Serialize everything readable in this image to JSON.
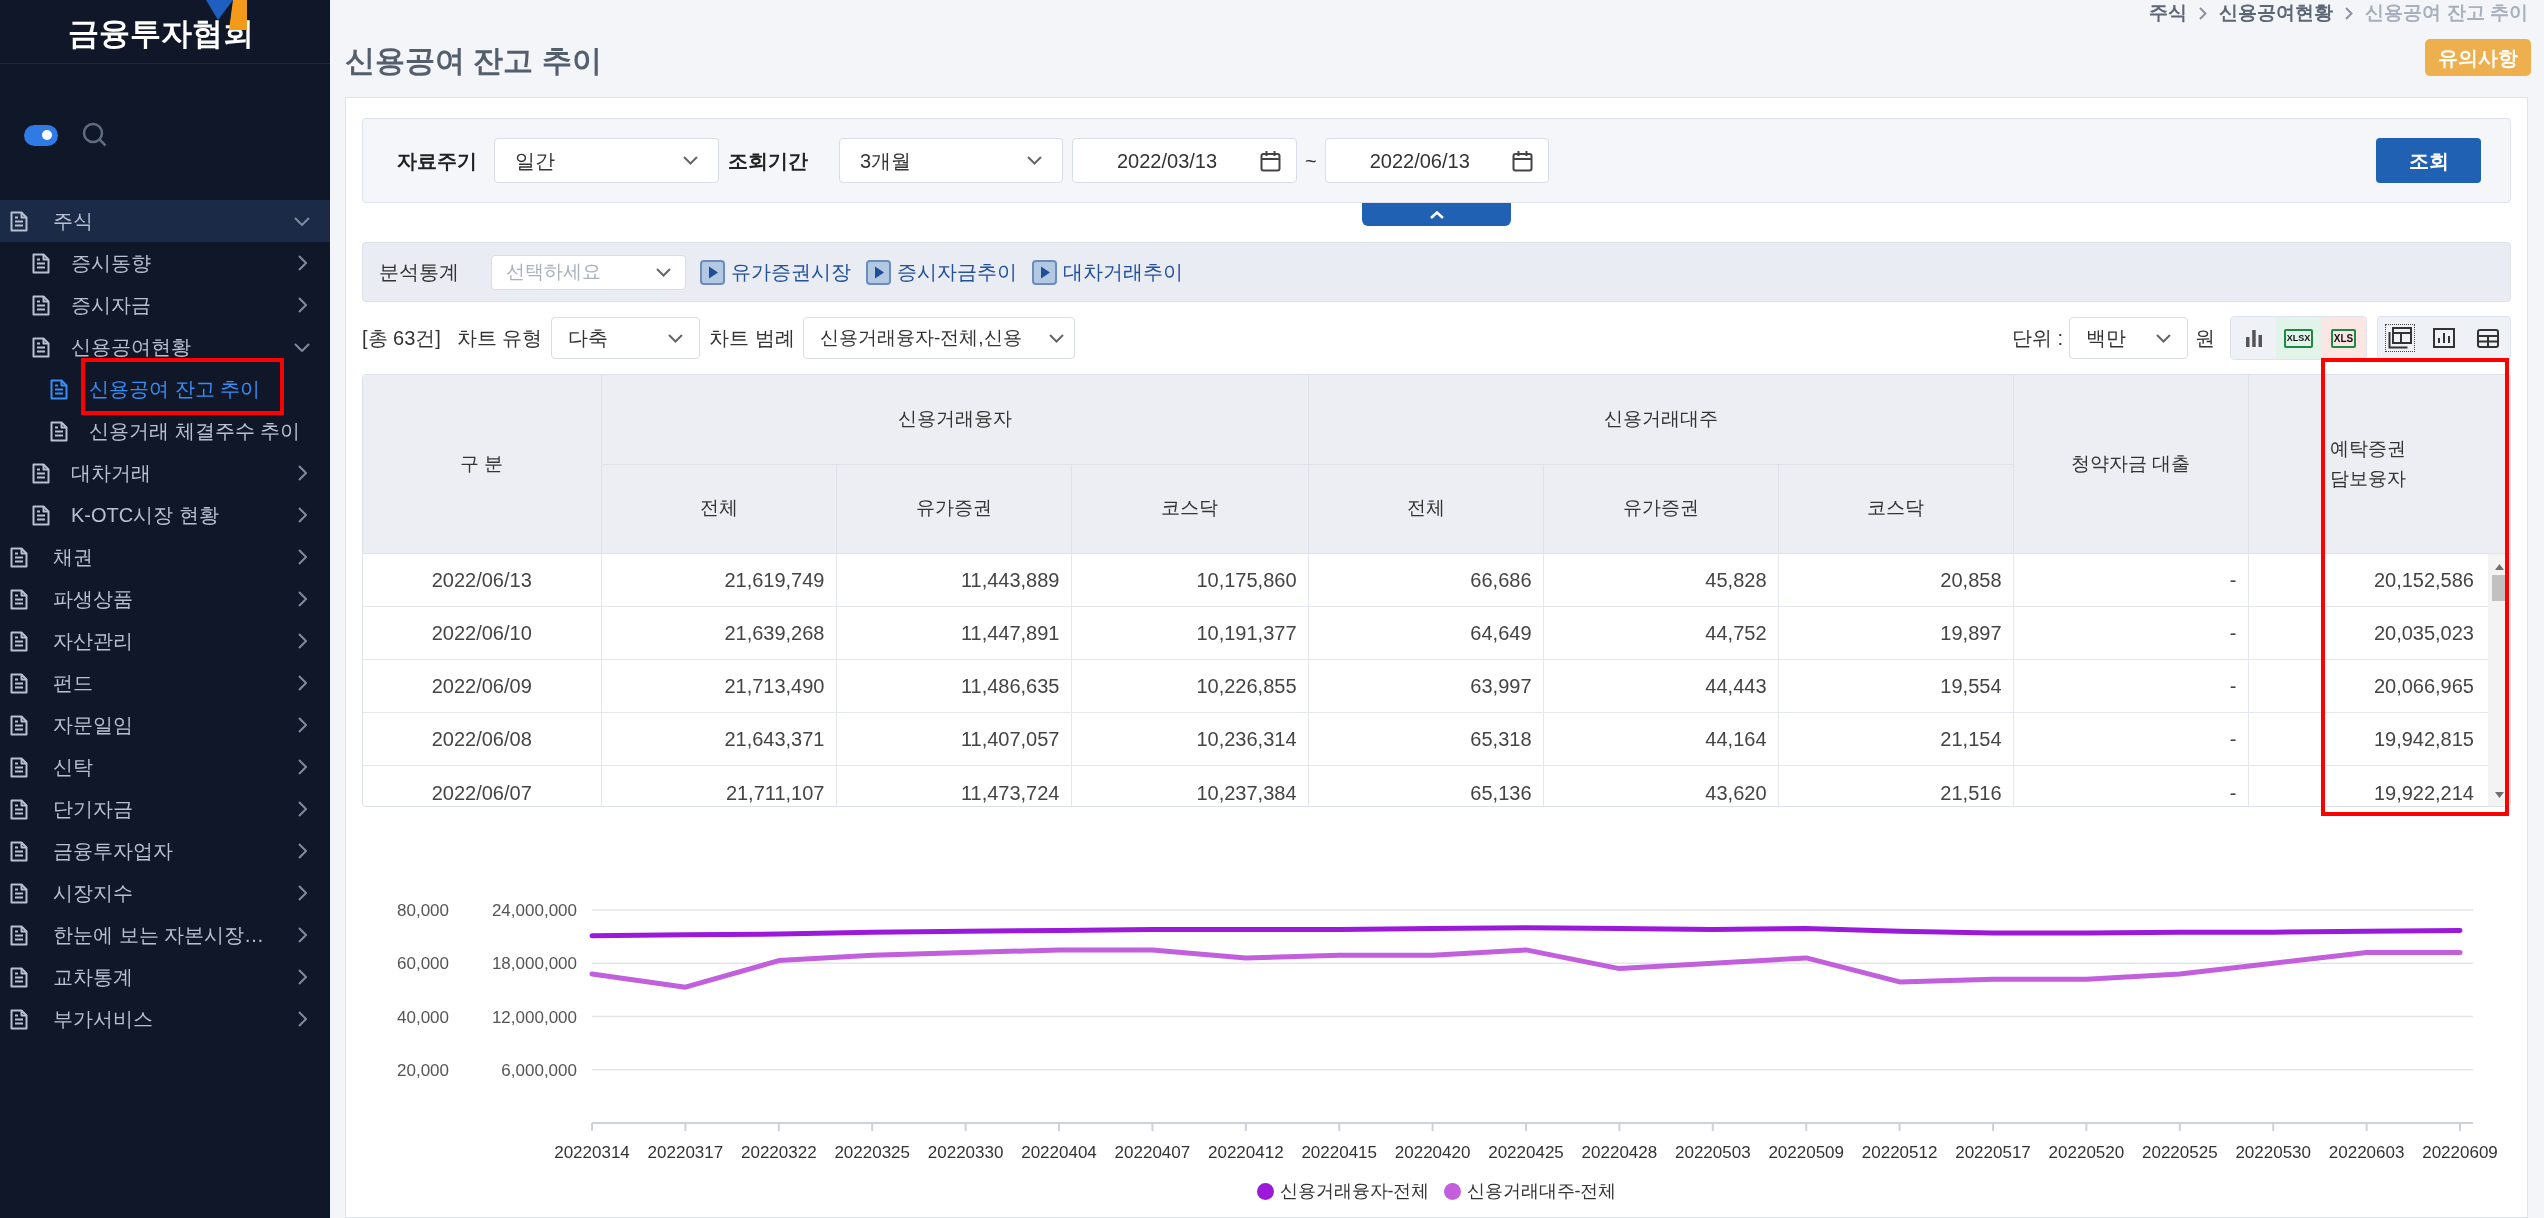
{
  "sidebar": {
    "logo": "금융투자협회",
    "toggle": {
      "on": true
    },
    "items": [
      {
        "label": "주식",
        "expanded": true,
        "selected": false,
        "children": [
          {
            "label": "증시동향",
            "expanded": false,
            "selected": false
          },
          {
            "label": "증시자금",
            "expanded": false,
            "selected": false
          },
          {
            "label": "신용공여현황",
            "expanded": true,
            "selected": false,
            "children": [
              {
                "label": "신용공여 잔고 추이",
                "selected": true,
                "annotated": true
              },
              {
                "label": "신용거래 체결주수 추이",
                "selected": false
              }
            ]
          },
          {
            "label": "대차거래",
            "expanded": false,
            "selected": false
          },
          {
            "label": "K-OTC시장 현황",
            "expanded": false,
            "selected": false
          }
        ]
      },
      {
        "label": "채권",
        "expanded": false,
        "selected": false
      },
      {
        "label": "파생상품",
        "expanded": false,
        "selected": false
      },
      {
        "label": "자산관리",
        "expanded": false,
        "selected": false
      },
      {
        "label": "펀드",
        "expanded": false,
        "selected": false
      },
      {
        "label": "자문일임",
        "expanded": false,
        "selected": false
      },
      {
        "label": "신탁",
        "expanded": false,
        "selected": false
      },
      {
        "label": "단기자금",
        "expanded": false,
        "selected": false
      },
      {
        "label": "금융투자업자",
        "expanded": false,
        "selected": false
      },
      {
        "label": "시장지수",
        "expanded": false,
        "selected": false
      },
      {
        "label": "한눈에 보는 자본시장…",
        "expanded": false,
        "selected": false
      },
      {
        "label": "교차통계",
        "expanded": false,
        "selected": false
      },
      {
        "label": "부가서비스",
        "expanded": false,
        "selected": false
      }
    ]
  },
  "breadcrumb": [
    {
      "label": "주식",
      "current": false
    },
    {
      "label": "신용공여현황",
      "current": false
    },
    {
      "label": "신용공여 잔고 추이",
      "current": true
    }
  ],
  "page_title": "신용공여 잔고 추이",
  "notice_button": "유의사항",
  "filters": {
    "period": {
      "label": "자료주기",
      "value": "일간"
    },
    "range": {
      "label": "조회기간",
      "value": "3개월"
    },
    "start_date": "2022/03/13",
    "date_separator": "~",
    "end_date": "2022/06/13",
    "search_button": "조회",
    "expanded": true
  },
  "analysis": {
    "label": "분석통계",
    "select": {
      "placeholder": "선택하세요"
    },
    "links": [
      "유가증권시장",
      "증시자금추이",
      "대차거래추이"
    ]
  },
  "toolbar": {
    "total": "[총 63건]",
    "chart_type": {
      "label": "차트 유형",
      "value": "다축"
    },
    "chart_legend": {
      "label": "차트 범례",
      "value": "신용거래융자-전체,신용"
    },
    "unit": {
      "label": "단위 :",
      "value": "백만",
      "suffix": "원"
    },
    "export_buttons": [
      {
        "kind": "chart"
      },
      {
        "kind": "xlsx",
        "label": "XLSX"
      },
      {
        "kind": "xls",
        "label": "XLS"
      }
    ],
    "view_modes": [
      {
        "kind": "combined",
        "selected": true
      },
      {
        "kind": "chart",
        "selected": false
      },
      {
        "kind": "table",
        "selected": false
      }
    ]
  },
  "table": {
    "header": [
      {
        "label": "구 분"
      },
      {
        "label": "신용거래융자",
        "children": [
          "전체",
          "유가증권",
          "코스닥"
        ]
      },
      {
        "label": "신용거래대주",
        "children": [
          "전체",
          "유가증권",
          "코스닥"
        ]
      },
      {
        "label": "청약자금 대출"
      },
      {
        "label": "예탁증권\n담보융자",
        "annotated": true
      }
    ],
    "rows": [
      [
        "2022/06/13",
        "21,619,749",
        "11,443,889",
        "10,175,860",
        "66,686",
        "45,828",
        "20,858",
        "-",
        "20,152,586"
      ],
      [
        "2022/06/10",
        "21,639,268",
        "11,447,891",
        "10,191,377",
        "64,649",
        "44,752",
        "19,897",
        "-",
        "20,035,023"
      ],
      [
        "2022/06/09",
        "21,713,490",
        "11,486,635",
        "10,226,855",
        "63,997",
        "44,443",
        "19,554",
        "-",
        "20,066,965"
      ],
      [
        "2022/06/08",
        "21,643,371",
        "11,407,057",
        "10,236,314",
        "65,318",
        "44,164",
        "21,154",
        "-",
        "19,942,815"
      ],
      [
        "2022/06/07",
        "21,711,107",
        "11,473,724",
        "10,237,384",
        "65,136",
        "43,620",
        "21,516",
        "-",
        "19,922,214"
      ]
    ]
  },
  "chart": {
    "chart_data": {
      "type": "line",
      "categories": [
        "20220314",
        "20220317",
        "20220322",
        "20220325",
        "20220330",
        "20220404",
        "20220407",
        "20220412",
        "20220415",
        "20220420",
        "20220425",
        "20220428",
        "20220503",
        "20220509",
        "20220512",
        "20220517",
        "20220520",
        "20220525",
        "20220530",
        "20220603",
        "20220609"
      ],
      "series": [
        {
          "name": "신용거래융자-전체",
          "color": "#9b1ad9",
          "axis": "y2",
          "values": [
            21100000,
            21200000,
            21300000,
            21500000,
            21600000,
            21700000,
            21800000,
            21800000,
            21800000,
            21900000,
            22000000,
            21900000,
            21800000,
            21900000,
            21600000,
            21400000,
            21400000,
            21500000,
            21500000,
            21600000,
            21700000
          ]
        },
        {
          "name": "신용거래대주-전체",
          "color": "#c25fdc",
          "values": [
            56000,
            51000,
            61000,
            63000,
            64000,
            65000,
            65000,
            62000,
            63000,
            63000,
            65000,
            58000,
            60000,
            62000,
            53000,
            54000,
            54000,
            56000,
            60000,
            64000,
            64000
          ]
        }
      ],
      "ylim": [
        0,
        80000
      ],
      "yticks": [
        {
          "value": 20000,
          "label": "20,000"
        },
        {
          "value": 40000,
          "label": "40,000"
        },
        {
          "value": 60000,
          "label": "60,000"
        },
        {
          "value": 80000,
          "label": "80,000"
        }
      ],
      "y2lim": [
        0,
        24000000
      ],
      "y2ticks": [
        {
          "value": 6000000,
          "label": "6,000,000"
        },
        {
          "value": 12000000,
          "label": "12,000,000"
        },
        {
          "value": 18000000,
          "label": "18,000,000"
        },
        {
          "value": 24000000,
          "label": "24,000,000"
        }
      ],
      "grid": true,
      "legend": "bottom"
    }
  }
}
